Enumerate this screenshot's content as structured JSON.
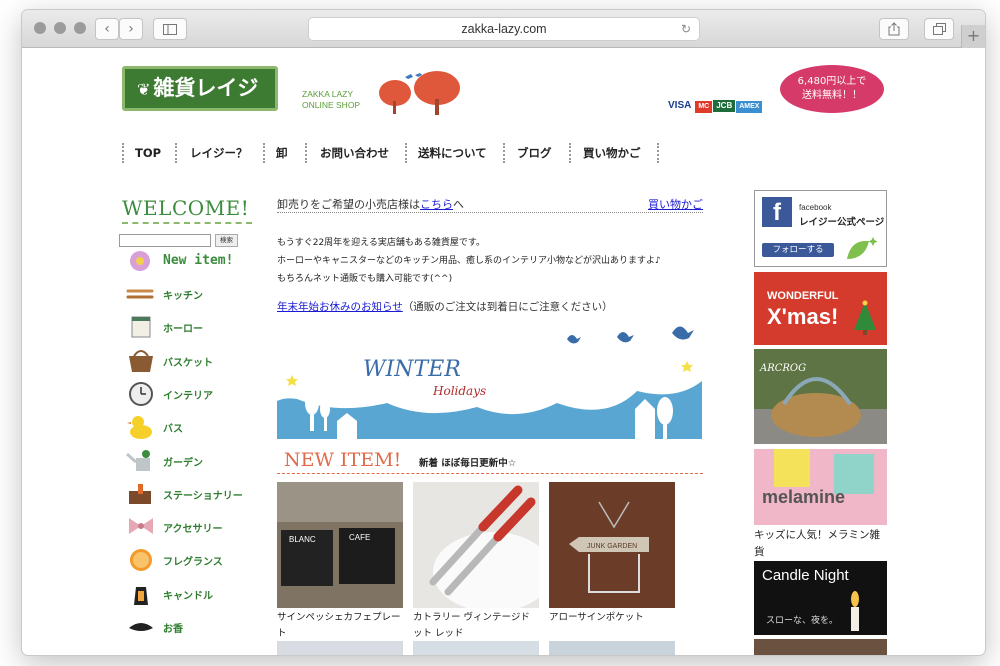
{
  "browser": {
    "url": "zakka-lazy.com"
  },
  "header": {
    "logo_text": "雑貨レイジー",
    "logo_sub1": "ZAKKA LAZY",
    "logo_sub2": "ONLINE SHOP",
    "cards": [
      "VISA",
      "MC",
      "JCB",
      "AMEX"
    ],
    "shipping_line1": "6,480円以上で",
    "shipping_line2": "送料無料！！"
  },
  "nav": {
    "items": [
      "TOP",
      "レイジー？",
      "卸",
      "お問い合わせ",
      "送料について",
      "ブログ",
      "買い物かご"
    ]
  },
  "sidebar": {
    "welcome": "WELCOME!",
    "search_button": "検索",
    "new_item": "New item!",
    "items": [
      {
        "label": "キッチン",
        "icon": "kitchen-utensils-icon"
      },
      {
        "label": "ホーロー",
        "icon": "enamel-canister-icon"
      },
      {
        "label": "バスケット",
        "icon": "basket-icon"
      },
      {
        "label": "インテリア",
        "icon": "clock-icon"
      },
      {
        "label": "バス",
        "icon": "rubber-duck-icon"
      },
      {
        "label": "ガーデン",
        "icon": "watering-can-icon"
      },
      {
        "label": "ステーショナリー",
        "icon": "stationery-icon"
      },
      {
        "label": "アクセサリー",
        "icon": "ribbon-icon"
      },
      {
        "label": "フレグランス",
        "icon": "orange-slice-icon"
      },
      {
        "label": "キャンドル",
        "icon": "lantern-icon"
      },
      {
        "label": "お香",
        "icon": "incense-icon"
      }
    ]
  },
  "main": {
    "intro_text": "卸売りをご希望の小売店様は",
    "intro_link": "こちら",
    "intro_suffix": "へ",
    "cart_link": "買い物かご",
    "para1": "もうすぐ22周年を迎える実店舗もある雑貨屋です。",
    "para2": "ホーローやキャニスターなどのキッチン用品、癒し系のインテリア小物などが沢山ありますよ♪",
    "para3": "もちろんネット通販でも購入可能です(^^)",
    "notice_link": "年末年始お休みのお知らせ",
    "notice_text": "（通販のご注文は到着日にご注意ください）",
    "banner_title": "WINTER",
    "banner_sub": "Holidays",
    "new_title": "NEW ITEM!",
    "new_sub": "新着 ほぼ毎日更新中☆",
    "products": [
      {
        "name": "サインペッシェカフェプレート"
      },
      {
        "name": "カトラリー ヴィンテージドット レッド"
      },
      {
        "name": "アローサインポケット"
      }
    ],
    "product_sign1": "BLANC",
    "product_sign2": "CAFE",
    "product_arrow": "JUNK GARDEN"
  },
  "right": {
    "fb_label": "facebook",
    "fb_page": "レイジー公式ページ",
    "fb_follow": "フォローする",
    "xmas_title": "WONDERFUL",
    "xmas_big": "X'mas!",
    "basket_label": "ARCROG",
    "melamine_label": "melamine",
    "melamine_caption": "キッズに人気！メラミン雑貨",
    "candle_title": "Candle Night",
    "candle_sub": "スローな、夜を。"
  }
}
